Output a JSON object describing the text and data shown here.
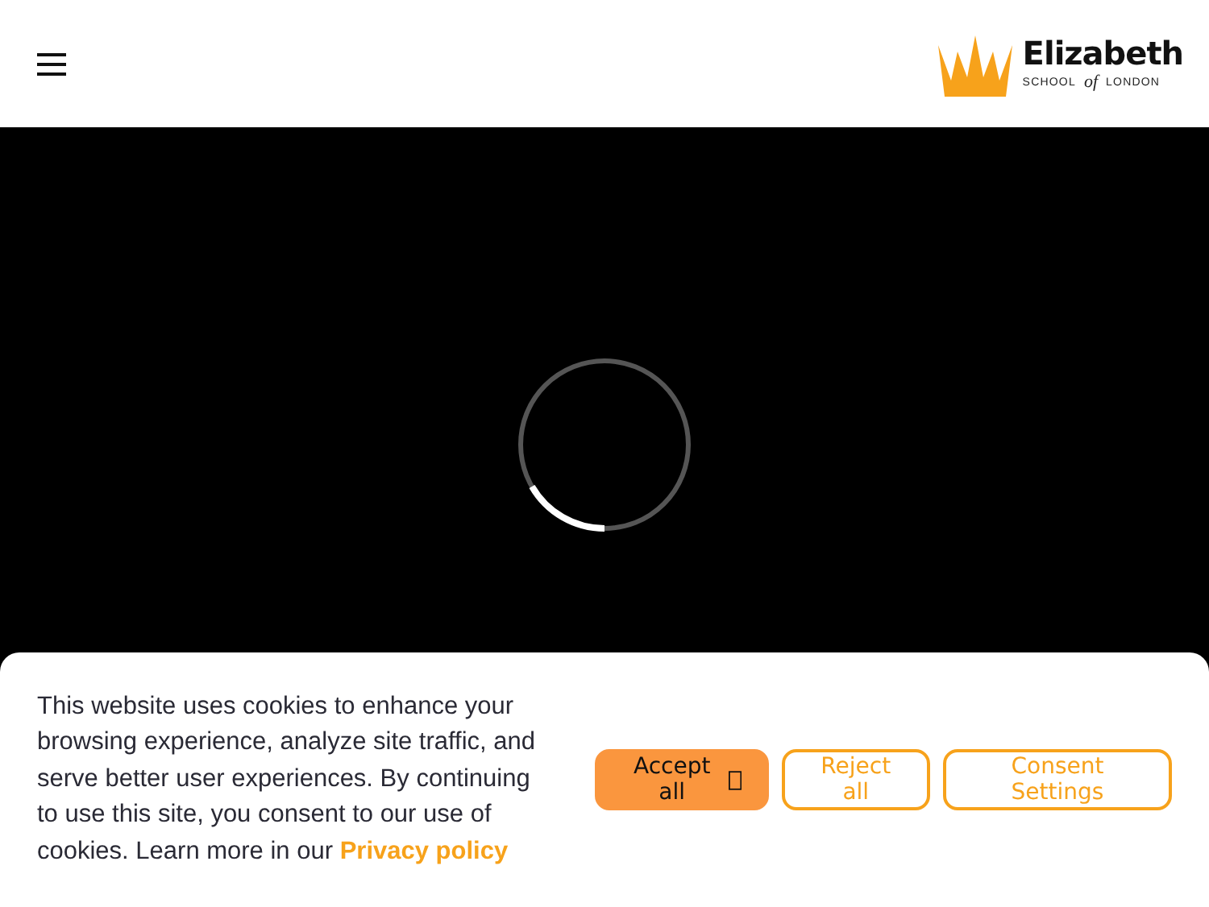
{
  "header": {
    "logo": {
      "name": "Elizabeth",
      "tagline": [
        "SCHOOL",
        "of",
        "LONDON"
      ]
    }
  },
  "video": {
    "loading": true
  },
  "cookie_banner": {
    "message": "This website uses cookies to enhance your browsing experience, analyze site traffic, and serve better user experiences. By continuing to use this site, you consent to our use of cookies. Learn more in our",
    "link": "Privacy policy",
    "buttons": [
      {
        "label": "Accept all",
        "kind": "primary"
      },
      {
        "label": "Reject all",
        "kind": "outline"
      },
      {
        "label": "Consent Settings",
        "kind": "outline"
      }
    ]
  }
}
